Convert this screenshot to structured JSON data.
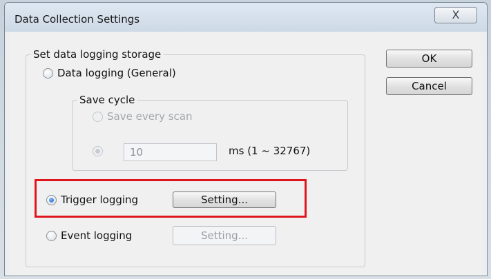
{
  "window": {
    "title": "Data Collection Settings",
    "close_glyph": "X"
  },
  "storage_group": {
    "legend": "Set data logging storage"
  },
  "general": {
    "label": "Data logging (General)",
    "checked": false
  },
  "save_cycle": {
    "legend": "Save cycle",
    "every_scan_label": "Save every scan",
    "interval_value": "10",
    "interval_unit": "ms (1 ~ 32767)"
  },
  "trigger": {
    "label": "Trigger logging",
    "checked": true,
    "setting_label": "Setting..."
  },
  "event": {
    "label": "Event logging",
    "checked": false,
    "setting_label": "Setting..."
  },
  "buttons": {
    "ok": "OK",
    "cancel": "Cancel"
  },
  "colors": {
    "highlight": "#e0161e",
    "radio_selected": "#1e5fb8"
  }
}
